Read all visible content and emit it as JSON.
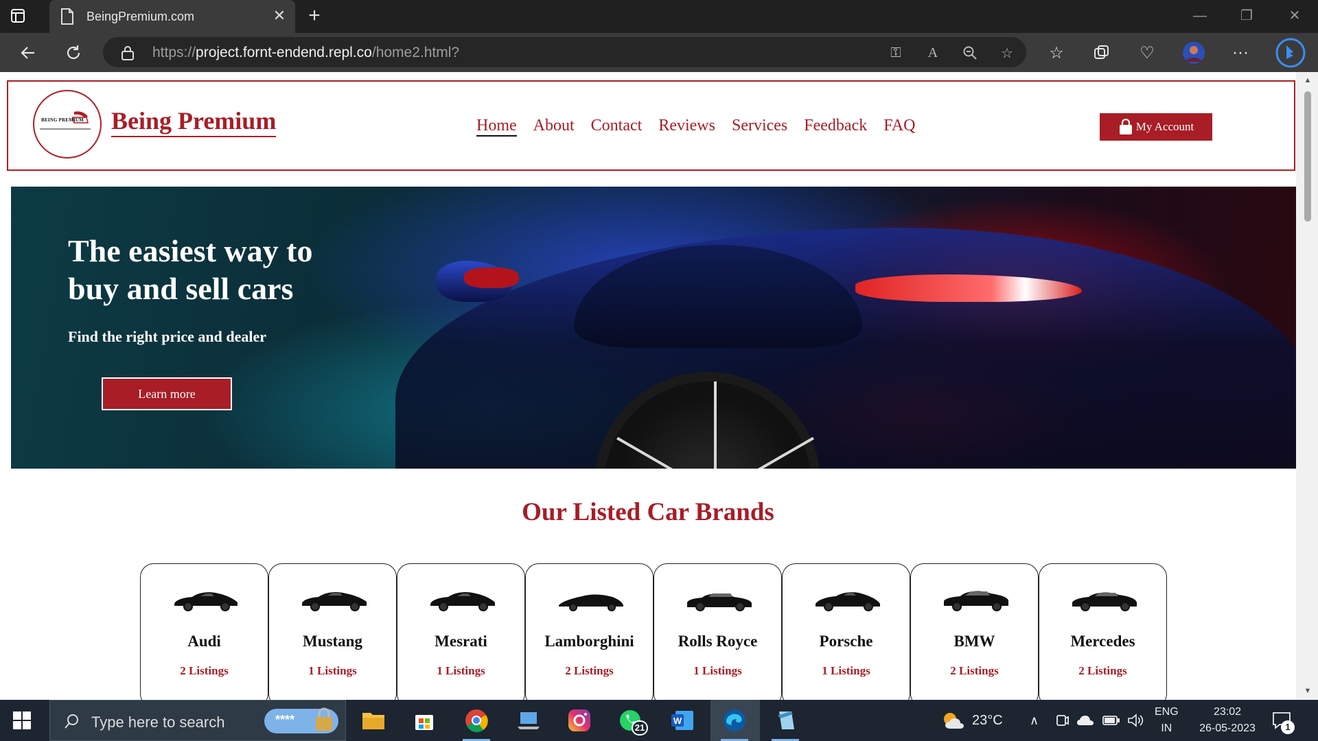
{
  "browser": {
    "tab_title": "BeingPremium.com",
    "url_prefix": "https://",
    "url_host": "project.fornt-endend.repl.co",
    "url_path": "/home2.html?"
  },
  "site": {
    "logo_small_text": "BEING PREMIUM",
    "brand_name": "Being Premium",
    "nav": [
      "Home",
      "About",
      "Contact",
      "Reviews",
      "Services",
      "Feedback",
      "FAQ"
    ],
    "active_nav": "Home",
    "account_label": "My Account",
    "accent_color": "#a81d26"
  },
  "hero": {
    "title": "The easiest way to buy and sell cars",
    "subtitle": "Find the right price and dealer",
    "button_label": "Learn more"
  },
  "brands_section": {
    "title": "Our Listed Car Brands",
    "brands": [
      {
        "name": "Audi",
        "listings": "2 Listings"
      },
      {
        "name": "Mustang",
        "listings": "1 Listings"
      },
      {
        "name": "Mesrati",
        "listings": "1 Listings"
      },
      {
        "name": "Lamborghini",
        "listings": "2 Listings"
      },
      {
        "name": "Rolls Royce",
        "listings": "1 Listings"
      },
      {
        "name": "Porsche",
        "listings": "1 Listings"
      },
      {
        "name": "BMW",
        "listings": "2 Listings"
      },
      {
        "name": "Mercedes",
        "listings": "2 Listings"
      }
    ]
  },
  "taskbar": {
    "search_placeholder": "Type here to search",
    "search_badge_text": "****",
    "whatsapp_badge": "21",
    "weather": "23°C",
    "lang_line1": "ENG",
    "lang_line2": "IN",
    "time": "23:02",
    "date": "26-05-2023",
    "notification_count": "1"
  }
}
